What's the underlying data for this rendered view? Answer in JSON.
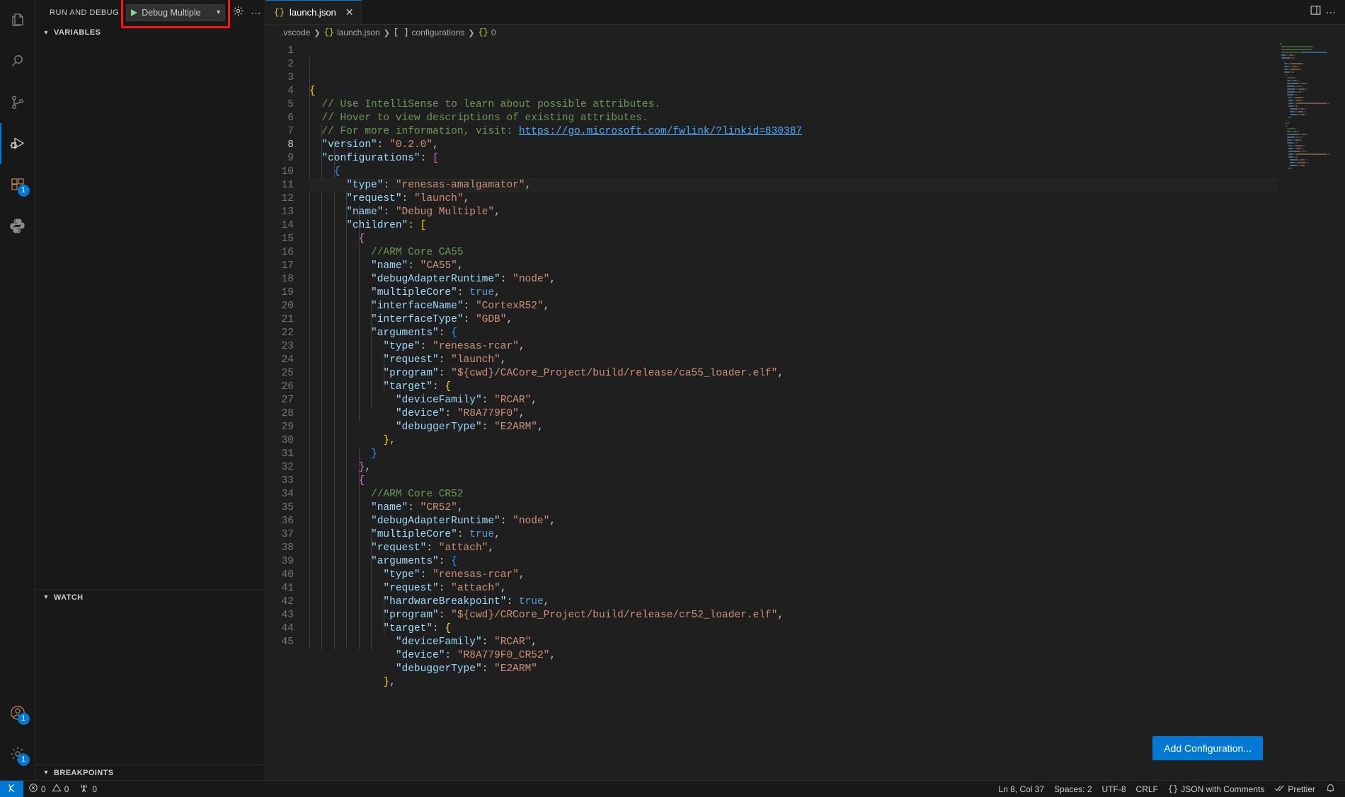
{
  "activity_bar": {
    "items": [
      {
        "name": "explorer",
        "icon": "files-icon",
        "active": false,
        "badge": ""
      },
      {
        "name": "search",
        "icon": "search-icon",
        "active": false,
        "badge": ""
      },
      {
        "name": "source-control",
        "icon": "source-control-icon",
        "active": false,
        "badge": ""
      },
      {
        "name": "run-and-debug",
        "icon": "debug-icon",
        "active": true,
        "badge": ""
      },
      {
        "name": "extensions",
        "icon": "extensions-icon",
        "active": false,
        "badge": "1"
      },
      {
        "name": "python",
        "icon": "python-icon",
        "active": false,
        "badge": ""
      }
    ],
    "bottom_items": [
      {
        "name": "accounts",
        "icon": "account-icon",
        "badge": "1"
      },
      {
        "name": "manage",
        "icon": "gear-icon",
        "badge": "1"
      }
    ]
  },
  "sidebar": {
    "title": "RUN AND DEBUG",
    "debug_config": {
      "selected": "Debug Multiple",
      "play_icon": "play-icon",
      "dropdown_icon": "chevron-down-icon",
      "highlighted": true,
      "highlight_color": "#f91616"
    },
    "actions": [
      {
        "name": "open-launch-json",
        "icon": "gear-icon"
      },
      {
        "name": "more-actions",
        "icon": "ellipsis-icon"
      }
    ],
    "panes": [
      {
        "name": "variables",
        "title": "VARIABLES",
        "expanded": true,
        "items": []
      },
      {
        "name": "watch",
        "title": "WATCH",
        "expanded": true,
        "items": []
      },
      {
        "name": "breakpoints",
        "title": "BREAKPOINTS",
        "expanded": true,
        "items": []
      }
    ]
  },
  "editor": {
    "tab": {
      "label": "launch.json",
      "icon": "json-file-icon",
      "icon_glyph": "{}",
      "close_icon": "close-icon",
      "active": true
    },
    "tab_actions": [
      {
        "name": "split-editor",
        "icon": "split-editor-icon"
      },
      {
        "name": "more-editor-actions",
        "icon": "ellipsis-icon"
      }
    ],
    "breadcrumbs": [
      {
        "label": ".vscode",
        "icon": ""
      },
      {
        "label": "launch.json",
        "icon": "{}"
      },
      {
        "label": "configurations",
        "icon": "[ ]"
      },
      {
        "label": "0",
        "icon": "{}"
      }
    ],
    "add_configuration_button": "Add Configuration...",
    "current_line": 8,
    "first_line": 1,
    "lines": [
      {
        "n": 1,
        "indent": 0,
        "tokens": [
          {
            "t": "p0",
            "s": "{"
          }
        ]
      },
      {
        "n": 2,
        "indent": 1,
        "tokens": [
          {
            "t": "cmt",
            "s": "// Use IntelliSense to learn about possible attributes."
          }
        ]
      },
      {
        "n": 3,
        "indent": 1,
        "tokens": [
          {
            "t": "cmt",
            "s": "// Hover to view descriptions of existing attributes."
          }
        ]
      },
      {
        "n": 4,
        "indent": 1,
        "tokens": [
          {
            "t": "cmt",
            "s": "// For more information, visit: "
          },
          {
            "t": "link",
            "s": "https://go.microsoft.com/fwlink/?linkid=830387"
          }
        ]
      },
      {
        "n": 5,
        "indent": 1,
        "tokens": [
          {
            "t": "key",
            "s": "\"version\""
          },
          {
            "t": "punc",
            "s": ": "
          },
          {
            "t": "str",
            "s": "\"0.2.0\""
          },
          {
            "t": "punc",
            "s": ","
          }
        ]
      },
      {
        "n": 6,
        "indent": 1,
        "tokens": [
          {
            "t": "key",
            "s": "\"configurations\""
          },
          {
            "t": "punc",
            "s": ": "
          },
          {
            "t": "p1",
            "s": "["
          }
        ]
      },
      {
        "n": 7,
        "indent": 2,
        "tokens": [
          {
            "t": "p2",
            "s": "{"
          }
        ]
      },
      {
        "n": 8,
        "indent": 3,
        "tokens": [
          {
            "t": "key",
            "s": "\"type\""
          },
          {
            "t": "punc",
            "s": ": "
          },
          {
            "t": "str",
            "s": "\"renesas-amalgamator\""
          },
          {
            "t": "punc",
            "s": ","
          }
        ]
      },
      {
        "n": 9,
        "indent": 3,
        "tokens": [
          {
            "t": "key",
            "s": "\"request\""
          },
          {
            "t": "punc",
            "s": ": "
          },
          {
            "t": "str",
            "s": "\"launch\""
          },
          {
            "t": "punc",
            "s": ","
          }
        ]
      },
      {
        "n": 10,
        "indent": 3,
        "tokens": [
          {
            "t": "key",
            "s": "\"name\""
          },
          {
            "t": "punc",
            "s": ": "
          },
          {
            "t": "str",
            "s": "\"Debug Multiple\""
          },
          {
            "t": "punc",
            "s": ","
          }
        ]
      },
      {
        "n": 11,
        "indent": 3,
        "tokens": [
          {
            "t": "key",
            "s": "\"children\""
          },
          {
            "t": "punc",
            "s": ": "
          },
          {
            "t": "p0",
            "s": "["
          }
        ]
      },
      {
        "n": 12,
        "indent": 4,
        "tokens": [
          {
            "t": "p1",
            "s": "{"
          }
        ]
      },
      {
        "n": 13,
        "indent": 5,
        "tokens": [
          {
            "t": "cmt",
            "s": "//ARM Core CA55"
          }
        ]
      },
      {
        "n": 14,
        "indent": 5,
        "tokens": [
          {
            "t": "key",
            "s": "\"name\""
          },
          {
            "t": "punc",
            "s": ": "
          },
          {
            "t": "str",
            "s": "\"CA55\""
          },
          {
            "t": "punc",
            "s": ","
          }
        ]
      },
      {
        "n": 15,
        "indent": 5,
        "tokens": [
          {
            "t": "key",
            "s": "\"debugAdapterRuntime\""
          },
          {
            "t": "punc",
            "s": ": "
          },
          {
            "t": "str",
            "s": "\"node\""
          },
          {
            "t": "punc",
            "s": ","
          }
        ]
      },
      {
        "n": 16,
        "indent": 5,
        "tokens": [
          {
            "t": "key",
            "s": "\"multipleCore\""
          },
          {
            "t": "punc",
            "s": ": "
          },
          {
            "t": "bool",
            "s": "true"
          },
          {
            "t": "punc",
            "s": ","
          }
        ]
      },
      {
        "n": 17,
        "indent": 5,
        "tokens": [
          {
            "t": "key",
            "s": "\"interfaceName\""
          },
          {
            "t": "punc",
            "s": ": "
          },
          {
            "t": "str",
            "s": "\"CortexR52\""
          },
          {
            "t": "punc",
            "s": ","
          }
        ]
      },
      {
        "n": 18,
        "indent": 5,
        "tokens": [
          {
            "t": "key",
            "s": "\"interfaceType\""
          },
          {
            "t": "punc",
            "s": ": "
          },
          {
            "t": "str",
            "s": "\"GDB\""
          },
          {
            "t": "punc",
            "s": ","
          }
        ]
      },
      {
        "n": 19,
        "indent": 5,
        "tokens": [
          {
            "t": "key",
            "s": "\"arguments\""
          },
          {
            "t": "punc",
            "s": ": "
          },
          {
            "t": "p2",
            "s": "{"
          }
        ]
      },
      {
        "n": 20,
        "indent": 6,
        "tokens": [
          {
            "t": "key",
            "s": "\"type\""
          },
          {
            "t": "punc",
            "s": ": "
          },
          {
            "t": "str",
            "s": "\"renesas-rcar\""
          },
          {
            "t": "punc",
            "s": ","
          }
        ]
      },
      {
        "n": 21,
        "indent": 6,
        "tokens": [
          {
            "t": "key",
            "s": "\"request\""
          },
          {
            "t": "punc",
            "s": ": "
          },
          {
            "t": "str",
            "s": "\"launch\""
          },
          {
            "t": "punc",
            "s": ","
          }
        ]
      },
      {
        "n": 22,
        "indent": 6,
        "tokens": [
          {
            "t": "key",
            "s": "\"program\""
          },
          {
            "t": "punc",
            "s": ": "
          },
          {
            "t": "str",
            "s": "\"${cwd}/CACore_Project/build/release/ca55_loader.elf\""
          },
          {
            "t": "punc",
            "s": ","
          }
        ]
      },
      {
        "n": 23,
        "indent": 6,
        "tokens": [
          {
            "t": "key",
            "s": "\"target\""
          },
          {
            "t": "punc",
            "s": ": "
          },
          {
            "t": "p0",
            "s": "{"
          }
        ]
      },
      {
        "n": 24,
        "indent": 7,
        "tokens": [
          {
            "t": "key",
            "s": "\"deviceFamily\""
          },
          {
            "t": "punc",
            "s": ": "
          },
          {
            "t": "str",
            "s": "\"RCAR\""
          },
          {
            "t": "punc",
            "s": ","
          }
        ]
      },
      {
        "n": 25,
        "indent": 7,
        "tokens": [
          {
            "t": "key",
            "s": "\"device\""
          },
          {
            "t": "punc",
            "s": ": "
          },
          {
            "t": "str",
            "s": "\"R8A779F0\""
          },
          {
            "t": "punc",
            "s": ","
          }
        ]
      },
      {
        "n": 26,
        "indent": 7,
        "tokens": [
          {
            "t": "key",
            "s": "\"debuggerType\""
          },
          {
            "t": "punc",
            "s": ": "
          },
          {
            "t": "str",
            "s": "\"E2ARM\""
          },
          {
            "t": "punc",
            "s": ","
          }
        ]
      },
      {
        "n": 27,
        "indent": 6,
        "tokens": [
          {
            "t": "p0",
            "s": "}"
          },
          {
            "t": "punc",
            "s": ","
          }
        ]
      },
      {
        "n": 28,
        "indent": 5,
        "tokens": [
          {
            "t": "p2",
            "s": "}"
          }
        ]
      },
      {
        "n": 29,
        "indent": 4,
        "tokens": [
          {
            "t": "p1",
            "s": "}"
          },
          {
            "t": "punc",
            "s": ","
          }
        ]
      },
      {
        "n": 30,
        "indent": 4,
        "tokens": [
          {
            "t": "p1",
            "s": "{"
          }
        ]
      },
      {
        "n": 31,
        "indent": 5,
        "tokens": [
          {
            "t": "cmt",
            "s": "//ARM Core CR52"
          }
        ]
      },
      {
        "n": 32,
        "indent": 5,
        "tokens": [
          {
            "t": "key",
            "s": "\"name\""
          },
          {
            "t": "punc",
            "s": ": "
          },
          {
            "t": "str",
            "s": "\"CR52\""
          },
          {
            "t": "punc",
            "s": ","
          }
        ]
      },
      {
        "n": 33,
        "indent": 5,
        "tokens": [
          {
            "t": "key",
            "s": "\"debugAdapterRuntime\""
          },
          {
            "t": "punc",
            "s": ": "
          },
          {
            "t": "str",
            "s": "\"node\""
          },
          {
            "t": "punc",
            "s": ","
          }
        ]
      },
      {
        "n": 34,
        "indent": 5,
        "tokens": [
          {
            "t": "key",
            "s": "\"multipleCore\""
          },
          {
            "t": "punc",
            "s": ": "
          },
          {
            "t": "bool",
            "s": "true"
          },
          {
            "t": "punc",
            "s": ","
          }
        ]
      },
      {
        "n": 35,
        "indent": 5,
        "tokens": [
          {
            "t": "key",
            "s": "\"request\""
          },
          {
            "t": "punc",
            "s": ": "
          },
          {
            "t": "str",
            "s": "\"attach\""
          },
          {
            "t": "punc",
            "s": ","
          }
        ]
      },
      {
        "n": 36,
        "indent": 5,
        "tokens": [
          {
            "t": "key",
            "s": "\"arguments\""
          },
          {
            "t": "punc",
            "s": ": "
          },
          {
            "t": "p2",
            "s": "{"
          }
        ]
      },
      {
        "n": 37,
        "indent": 6,
        "tokens": [
          {
            "t": "key",
            "s": "\"type\""
          },
          {
            "t": "punc",
            "s": ": "
          },
          {
            "t": "str",
            "s": "\"renesas-rcar\""
          },
          {
            "t": "punc",
            "s": ","
          }
        ]
      },
      {
        "n": 38,
        "indent": 6,
        "tokens": [
          {
            "t": "key",
            "s": "\"request\""
          },
          {
            "t": "punc",
            "s": ": "
          },
          {
            "t": "str",
            "s": "\"attach\""
          },
          {
            "t": "punc",
            "s": ","
          }
        ]
      },
      {
        "n": 39,
        "indent": 6,
        "tokens": [
          {
            "t": "key",
            "s": "\"hardwareBreakpoint\""
          },
          {
            "t": "punc",
            "s": ": "
          },
          {
            "t": "bool",
            "s": "true"
          },
          {
            "t": "punc",
            "s": ","
          }
        ]
      },
      {
        "n": 40,
        "indent": 6,
        "tokens": [
          {
            "t": "key",
            "s": "\"program\""
          },
          {
            "t": "punc",
            "s": ": "
          },
          {
            "t": "str",
            "s": "\"${cwd}/CRCore_Project/build/release/cr52_loader.elf\""
          },
          {
            "t": "punc",
            "s": ","
          }
        ]
      },
      {
        "n": 41,
        "indent": 6,
        "tokens": [
          {
            "t": "key",
            "s": "\"target\""
          },
          {
            "t": "punc",
            "s": ": "
          },
          {
            "t": "p0",
            "s": "{"
          }
        ]
      },
      {
        "n": 42,
        "indent": 7,
        "tokens": [
          {
            "t": "key",
            "s": "\"deviceFamily\""
          },
          {
            "t": "punc",
            "s": ": "
          },
          {
            "t": "str",
            "s": "\"RCAR\""
          },
          {
            "t": "punc",
            "s": ","
          }
        ]
      },
      {
        "n": 43,
        "indent": 7,
        "tokens": [
          {
            "t": "key",
            "s": "\"device\""
          },
          {
            "t": "punc",
            "s": ": "
          },
          {
            "t": "str",
            "s": "\"R8A779F0_CR52\""
          },
          {
            "t": "punc",
            "s": ","
          }
        ]
      },
      {
        "n": 44,
        "indent": 7,
        "tokens": [
          {
            "t": "key",
            "s": "\"debuggerType\""
          },
          {
            "t": "punc",
            "s": ": "
          },
          {
            "t": "str",
            "s": "\"E2ARM\""
          }
        ]
      },
      {
        "n": 45,
        "indent": 6,
        "tokens": [
          {
            "t": "p0",
            "s": "}"
          },
          {
            "t": "punc",
            "s": ","
          }
        ]
      }
    ]
  },
  "status_bar": {
    "remote_indicator": {
      "icon": "remote-icon",
      "label": ""
    },
    "problems": {
      "errors_icon": "error-icon",
      "errors": "0",
      "warnings_icon": "warning-icon",
      "warnings": "0"
    },
    "ports": {
      "icon": "radio-tower-icon",
      "count": "0"
    },
    "right_items": [
      {
        "name": "editor-position",
        "label": "Ln 8, Col 37"
      },
      {
        "name": "editor-indentation",
        "label": "Spaces: 2"
      },
      {
        "name": "editor-encoding",
        "label": "UTF-8"
      },
      {
        "name": "editor-eol",
        "label": "CRLF"
      },
      {
        "name": "editor-language",
        "label": "JSON with Comments",
        "icon": "{}"
      },
      {
        "name": "prettier-status",
        "label": "Prettier",
        "icon": "check-all-icon"
      },
      {
        "name": "notifications",
        "label": "",
        "icon": "bell-icon"
      }
    ]
  }
}
